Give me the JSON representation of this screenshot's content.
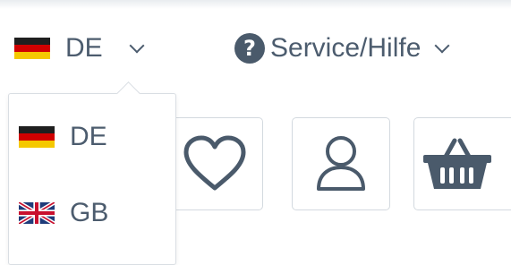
{
  "header": {
    "current_language": "DE",
    "service_label": "Service/Hilfe",
    "help_glyph": "?"
  },
  "language_dropdown": {
    "items": [
      {
        "code": "DE",
        "flag": "germany-flag-icon"
      },
      {
        "code": "GB",
        "flag": "uk-flag-icon"
      }
    ]
  },
  "icons": {
    "wishlist": "heart-icon",
    "account": "user-icon",
    "cart": "basket-icon"
  },
  "colors": {
    "text": "#4c5c6e",
    "border": "#d3d9df",
    "icon": "#4a5a6b"
  }
}
